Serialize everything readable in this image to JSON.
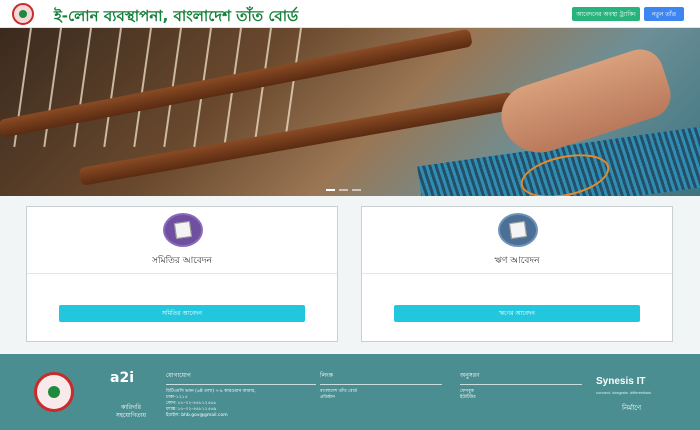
{
  "header": {
    "title": "ই-লোন ব্যবস্থাপনা, বাংলাদেশ তাঁত বোর্ড",
    "buttons": {
      "apply_tracking": "আবেদনের অবস্থা ট্র্যাকিং",
      "new": "নতুন তাঁত"
    }
  },
  "banner": {
    "slides": 3,
    "active_slide": 1
  },
  "cards": [
    {
      "title": "সমিতির আবেদন",
      "button": "সমিতির আবেদন",
      "icon": "document-icon",
      "icon_color": "#6f4fa0"
    },
    {
      "title": "ঋণ আবেদন",
      "button": "ঋণের আবেদন",
      "icon": "document-icon",
      "icon_color": "#4b6f95"
    }
  ],
  "footer": {
    "logo2_text": "a2i",
    "logo2_caption": "কারিগরি সহযোগিতায়",
    "contact": {
      "heading": "যোগাযোগ",
      "lines": [
        "বিটিএমসি ভবন (৬ষ্ঠ তলা) ৭-৯ কারওয়ান বাজার,",
        "ঢাকা-১২১৫",
        "ফোন: ৮৮-০২-৪৪৮১২৫৬৮",
        "ফ্যাক্স: ৮৮-০২-৪৪৮১২৫৬৯",
        "ইমেইল: bhb.gov@gmail.com"
      ]
    },
    "links": {
      "heading": "লিংক",
      "lines": [
        "বাংলাদেশ তাঁত বোর্ড",
        "প্রতিষ্ঠান"
      ]
    },
    "follow": {
      "heading": "অনুসরণ",
      "lines": [
        "ফেসবুক",
        "ইউটিউব"
      ]
    },
    "developer": "Synesis IT",
    "developer_tagline": "connect. integrate. differentiate.",
    "made_by": "নির্মাণে"
  },
  "colors": {
    "title_green": "#16813a",
    "footer_bg": "#4b8e92",
    "card_button": "#22c6dd",
    "button_green": "#26b37c",
    "button_blue": "#3d86f2"
  }
}
